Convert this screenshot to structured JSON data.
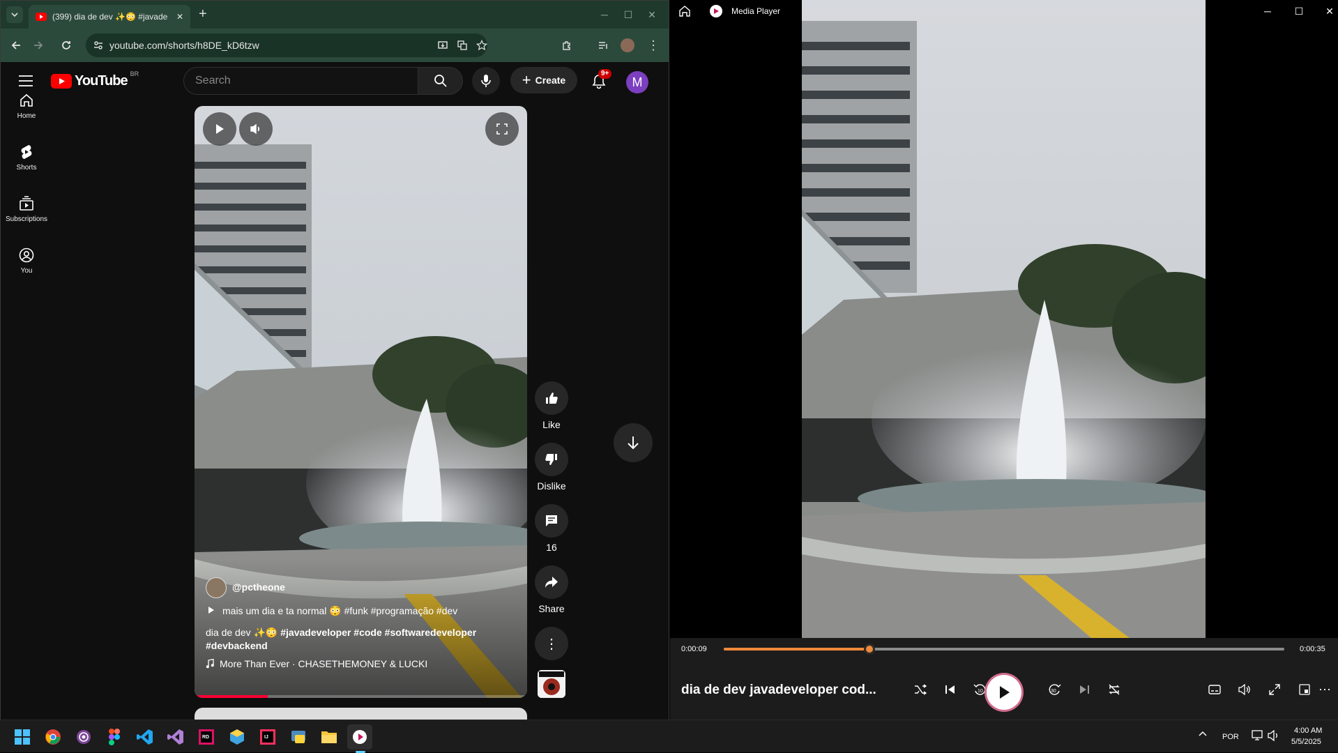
{
  "chrome": {
    "tab_title": "(399) dia de dev ✨😳 #javade",
    "url": "youtube.com/shorts/h8DE_kD6tzw",
    "close_tab": "✕",
    "new_tab": "+"
  },
  "youtube": {
    "logo_text": "YouTube",
    "logo_region": "BR",
    "search_placeholder": "Search",
    "create_label": "Create",
    "notif_badge": "9+",
    "avatar_letter": "M",
    "sidebar": [
      {
        "label": "Home",
        "icon": "home-icon"
      },
      {
        "label": "Shorts",
        "icon": "shorts-icon"
      },
      {
        "label": "Subscriptions",
        "icon": "subscriptions-icon"
      },
      {
        "label": "You",
        "icon": "you-icon"
      }
    ],
    "short": {
      "channel": "@pctheone",
      "audio_desc": "mais um dia e ta normal 😳 #funk #programação #dev",
      "desc_plain": "dia de dev ✨😳 ",
      "desc_tags": "#javadeveloper #code #softwaredeveloper #devbackend",
      "music": "More Than Ever · CHASETHEMONEY & LUCKI",
      "progress": 0.22
    },
    "actions": {
      "like": "Like",
      "dislike": "Dislike",
      "comments": "16",
      "share": "Share"
    }
  },
  "media_player": {
    "app_title": "Media Player",
    "time_current": "0:00:09",
    "time_total": "0:00:35",
    "progress": 0.26,
    "track_title": "dia de dev  javadeveloper cod..."
  },
  "taskbar": {
    "lang": "POR",
    "time": "4:00 AM",
    "date": "5/5/2025"
  },
  "colors": {
    "chrome_frame": "#1f3a2d",
    "youtube_red": "#ff0000",
    "mp_accent": "#f0893a"
  }
}
